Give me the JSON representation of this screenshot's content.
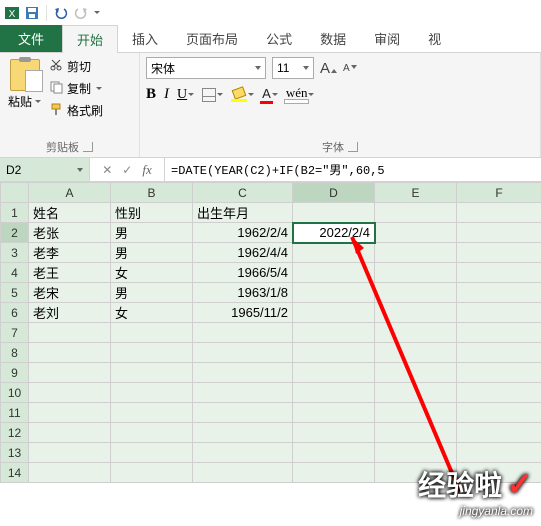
{
  "qat": {
    "icons": [
      "excel-icon",
      "save-icon",
      "undo-icon",
      "redo-icon"
    ]
  },
  "tabs": {
    "file": "文件",
    "items": [
      "开始",
      "插入",
      "页面布局",
      "公式",
      "数据",
      "审阅",
      "视"
    ],
    "active_index": 0
  },
  "ribbon": {
    "clipboard": {
      "paste": "粘贴",
      "cut": "剪切",
      "copy": "复制",
      "format_painter": "格式刷",
      "group_label": "剪贴板"
    },
    "font": {
      "name": "宋体",
      "size": "11",
      "group_label": "字体"
    }
  },
  "namebox": "D2",
  "formula": "=DATE(YEAR(C2)+IF(B2=\"男\",60,5",
  "columns": [
    "A",
    "B",
    "C",
    "D",
    "E",
    "F"
  ],
  "active_col_index": 3,
  "header_row": {
    "c1": "姓名",
    "c2": "性别",
    "c3": "出生年月"
  },
  "rows": [
    {
      "n": "2",
      "c1": "老张",
      "c2": "男",
      "c3": "1962/2/4",
      "c4": "2022/2/4"
    },
    {
      "n": "3",
      "c1": "老李",
      "c2": "男",
      "c3": "1962/4/4",
      "c4": ""
    },
    {
      "n": "4",
      "c1": "老王",
      "c2": "女",
      "c3": "1966/5/4",
      "c4": ""
    },
    {
      "n": "5",
      "c1": "老宋",
      "c2": "男",
      "c3": "1963/1/8",
      "c4": ""
    },
    {
      "n": "6",
      "c1": "老刘",
      "c2": "女",
      "c3": "1965/11/2",
      "c4": ""
    }
  ],
  "empty_rows": [
    "7",
    "8",
    "9",
    "10",
    "11",
    "12",
    "13",
    "14"
  ],
  "active_cell": "D2",
  "watermark": {
    "main": "经验啦",
    "sub": "jingyanla.com"
  }
}
